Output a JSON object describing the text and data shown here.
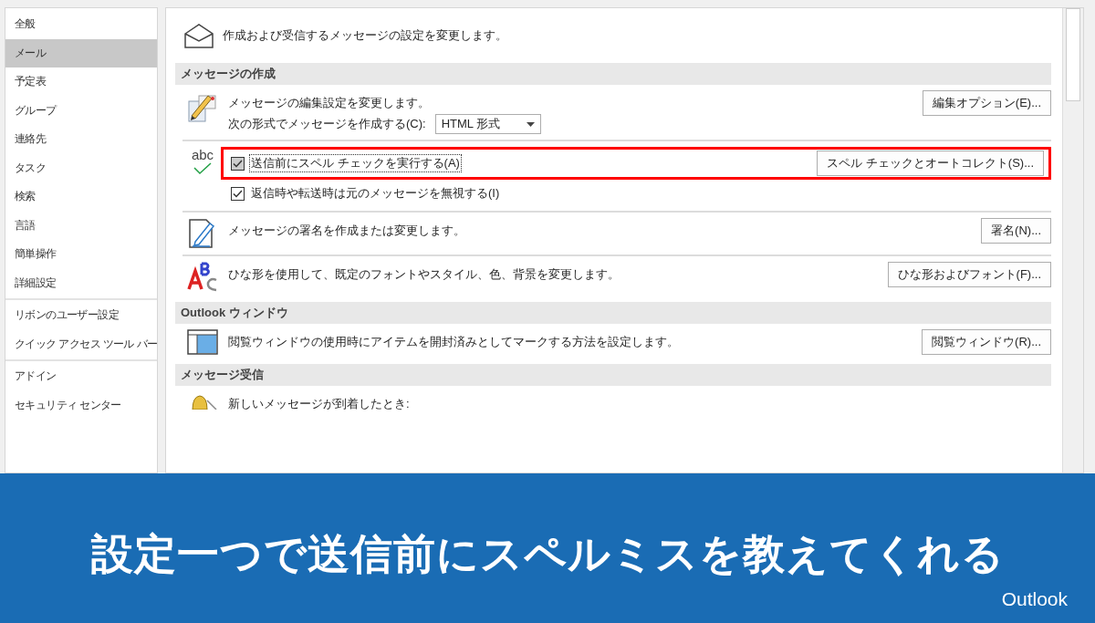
{
  "sidebar": {
    "groups": [
      [
        {
          "label": "全般",
          "selected": false
        },
        {
          "label": "メール",
          "selected": true
        },
        {
          "label": "予定表",
          "selected": false
        },
        {
          "label": "グループ",
          "selected": false
        },
        {
          "label": "連絡先",
          "selected": false
        },
        {
          "label": "タスク",
          "selected": false
        },
        {
          "label": "検索",
          "selected": false
        },
        {
          "label": "言語",
          "selected": false
        },
        {
          "label": "簡単操作",
          "selected": false
        },
        {
          "label": "詳細設定",
          "selected": false
        }
      ],
      [
        {
          "label": "リボンのユーザー設定",
          "selected": false
        },
        {
          "label": "クイック アクセス ツール バー",
          "selected": false
        }
      ],
      [
        {
          "label": "アドイン",
          "selected": false
        },
        {
          "label": "セキュリティ センター",
          "selected": false
        }
      ]
    ]
  },
  "main": {
    "header": "作成および受信するメッセージの設定を変更します。",
    "sections": [
      {
        "title": "メッセージの作成",
        "rows": [
          {
            "kind": "compose",
            "text": "メッセージの編集設定を変更します。",
            "format_label": "次の形式でメッセージを作成する(C):",
            "format_value": "HTML 形式",
            "button": "編集オプション(E)..."
          },
          {
            "kind": "checks",
            "icon_text": "abc",
            "checks": [
              {
                "label": "送信前にスペル チェックを実行する(A)",
                "checked": true,
                "focused": true,
                "highlighted": true
              },
              {
                "label": "返信時や転送時は元のメッセージを無視する(I)",
                "checked": true,
                "focused": false,
                "highlighted": false
              }
            ],
            "button": "スペル チェックとオートコレクト(S)..."
          },
          {
            "kind": "simple",
            "text": "メッセージの署名を作成または変更します。",
            "button": "署名(N)..."
          },
          {
            "kind": "simple",
            "text": "ひな形を使用して、既定のフォントやスタイル、色、背景を変更します。",
            "button": "ひな形およびフォント(F)..."
          }
        ]
      },
      {
        "title": "Outlook ウィンドウ",
        "rows": [
          {
            "kind": "simple",
            "text": "閲覧ウィンドウの使用時にアイテムを開封済みとしてマークする方法を設定します。",
            "button": "閲覧ウィンドウ(R)..."
          }
        ]
      },
      {
        "title": "メッセージ受信",
        "rows": [
          {
            "kind": "simple",
            "text": "新しいメッセージが到着したとき:"
          }
        ]
      }
    ]
  },
  "banner": {
    "title": "設定一つで送信前にスペルミスを教えてくれる",
    "brand": "Outlook"
  }
}
